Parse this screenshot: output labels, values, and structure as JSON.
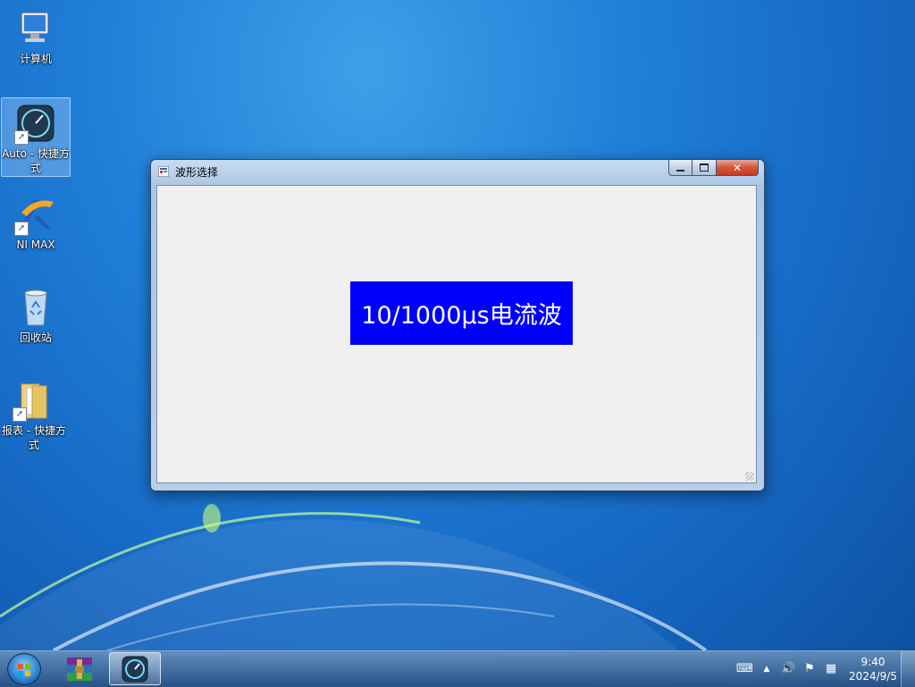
{
  "desktop": {
    "icons": [
      {
        "label": "计算机",
        "icon": "computer-icon"
      },
      {
        "label": "Auto - 快捷方式",
        "icon": "speedometer-icon"
      },
      {
        "label": "NI MAX",
        "icon": "ni-max-icon"
      },
      {
        "label": "回收站",
        "icon": "recycle-bin-icon"
      },
      {
        "label": "报表 - 快捷方式",
        "icon": "folder-icon"
      }
    ]
  },
  "window": {
    "title": "波形选择",
    "wave_button_label": "10/1000μs电流波"
  },
  "taskbar": {
    "items": [
      {
        "name": "winrar",
        "icon": "winrar-icon"
      },
      {
        "name": "auto",
        "icon": "speedometer-icon",
        "active": true
      }
    ],
    "clock": {
      "time": "9:40",
      "date": "2024/9/5"
    }
  },
  "colors": {
    "wave_button_bg": "#0000ff",
    "wave_button_text": "#ffffff",
    "client_bg": "#f0f0f0"
  }
}
